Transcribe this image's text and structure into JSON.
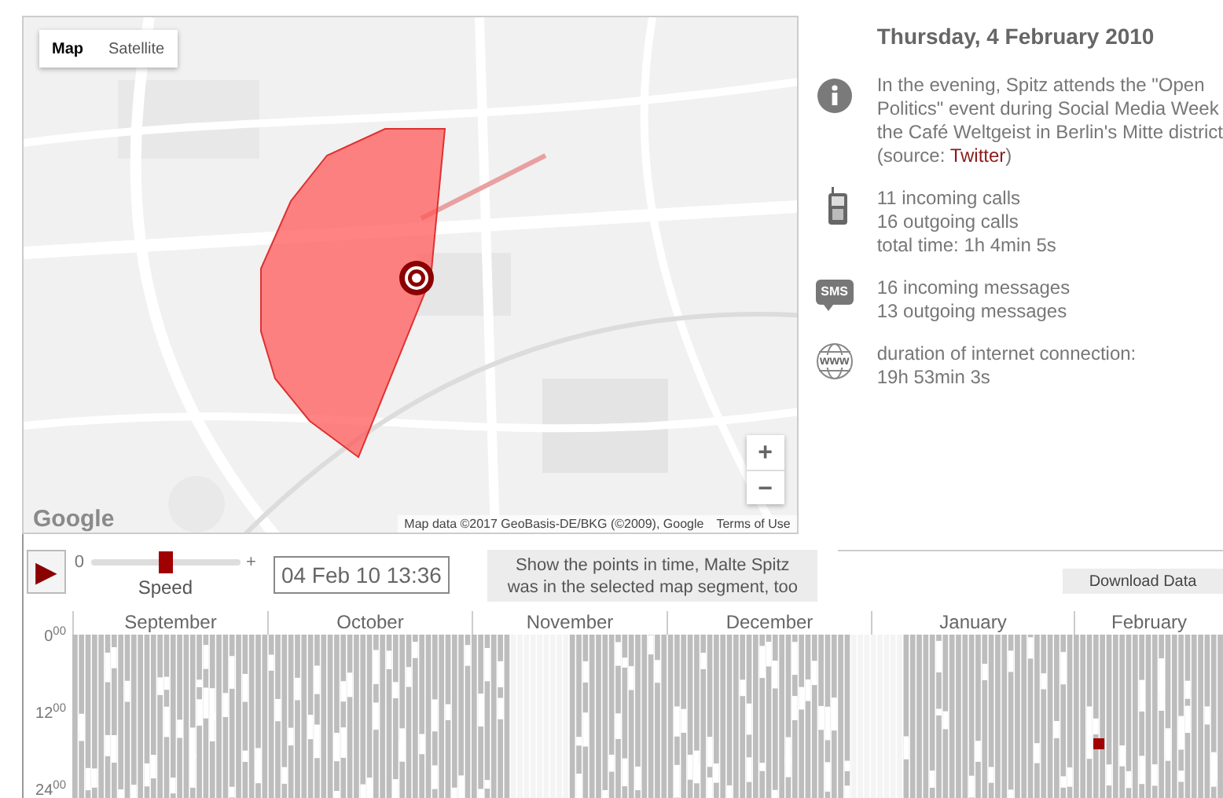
{
  "map": {
    "types": [
      {
        "label": "Map",
        "selected": true
      },
      {
        "label": "Satellite",
        "selected": false
      }
    ],
    "zoom_in": "+",
    "zoom_out": "−",
    "logo": "Google",
    "attribution": "Map data ©2017 GeoBasis-DE/BKG (©2009), Google",
    "terms": "Terms of Use"
  },
  "details": {
    "date": "Thursday, 4 February 2010",
    "sections": [
      {
        "kind": "info",
        "lines": [
          "In the evening, Spitz attends the \"Open",
          "Politics\" event during Social Media Week",
          "the Café Weltgeist in Berlin's Mitte district",
          "(source: "
        ],
        "link": "Twitter",
        "after": ")"
      },
      {
        "kind": "phone",
        "lines": [
          "11 incoming calls",
          "16 outgoing calls",
          "total time: 1h 4min 5s"
        ]
      },
      {
        "kind": "sms",
        "icon_text": "SMS",
        "lines": [
          "16 incoming messages",
          "13 outgoing messages"
        ]
      },
      {
        "kind": "web",
        "icon_text": "www",
        "lines": [
          "duration of internet connection:",
          "19h 53min 3s"
        ]
      }
    ]
  },
  "player": {
    "play_label": "▶",
    "speed_min": "0",
    "speed_max": "+",
    "speed_label": "Speed",
    "speed": {
      "level": 0.5
    },
    "time": "04 Feb 10 13:36"
  },
  "hint": [
    "Show the points in time, Malte Spitz",
    "was in the selected map segment, too"
  ],
  "download": "Download Data",
  "timeline": {
    "months": [
      "September",
      "October",
      "November",
      "December",
      "January",
      "February"
    ],
    "hours": [
      "0$^{00}$",
      "12$^{00}$",
      "24$^{00}$"
    ]
  }
}
